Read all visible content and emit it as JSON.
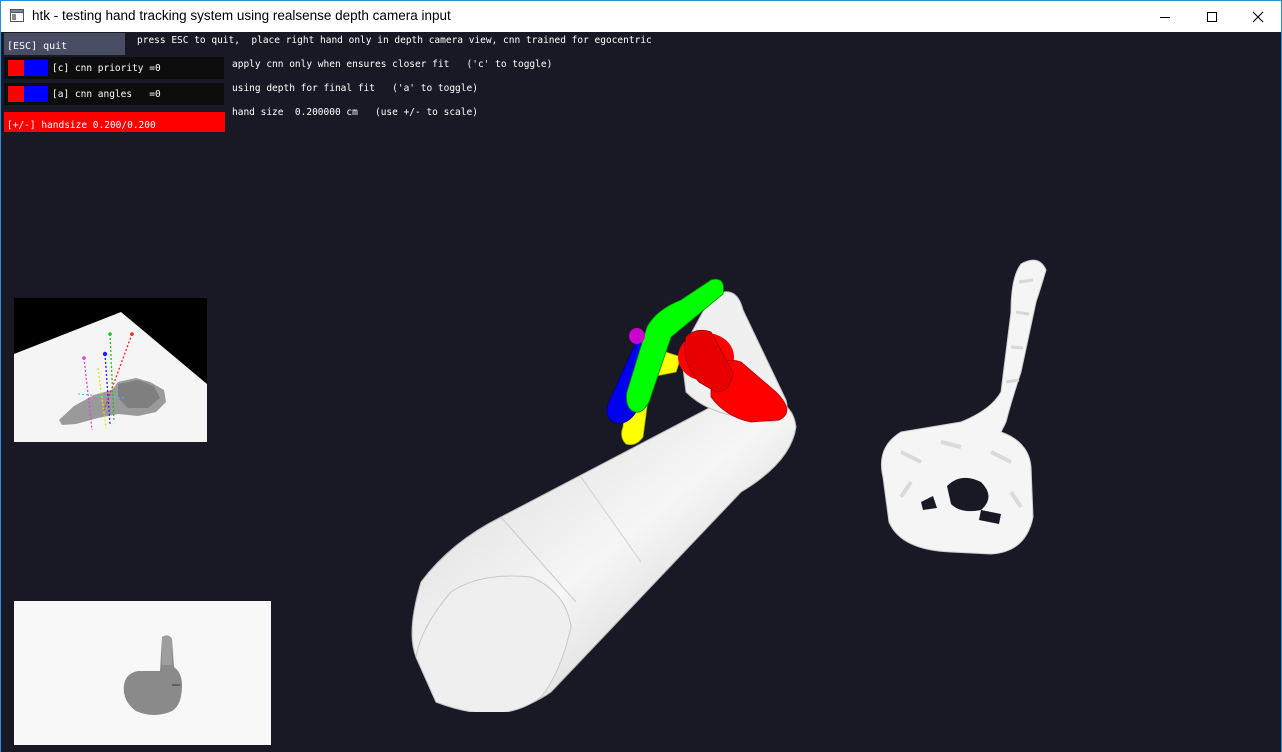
{
  "window": {
    "title": "htk - testing hand tracking system  using realsense depth camera input",
    "border_color": "#2a8fd8",
    "app_icon": "window-app-icon",
    "controls": [
      "minimize-icon",
      "maximize-icon",
      "close-icon"
    ]
  },
  "viewport": {
    "background": "#181924"
  },
  "panel": {
    "esc_button": "[ESC] quit",
    "toggles": [
      {
        "label": "[c] cnn priority =0"
      },
      {
        "label": "[a] cnn angles   =0"
      }
    ],
    "handsize_bar": "[+/-] handsize 0.200/0.200",
    "colors": {
      "red": "#ff0000",
      "blue": "#0000ff",
      "esc_bg": "#484d64"
    }
  },
  "info": {
    "line1": "press ESC to quit,  place right hand only in depth camera view, cnn trained for egocentric",
    "line2": "apply cnn only when ensures closer fit   ('c' to toggle)",
    "line3": "using depth for final fit   ('a' to toggle)",
    "line4": "hand size  0.200000 cm   (use +/- to scale)"
  },
  "scene": {
    "finger_colors": {
      "thumb": "#ff0000",
      "index": "#00ff00",
      "middle": "#0000ff",
      "ring": "#ffff00",
      "pinky": "#cc00cc"
    },
    "arm_color": "#f0f0f0"
  }
}
